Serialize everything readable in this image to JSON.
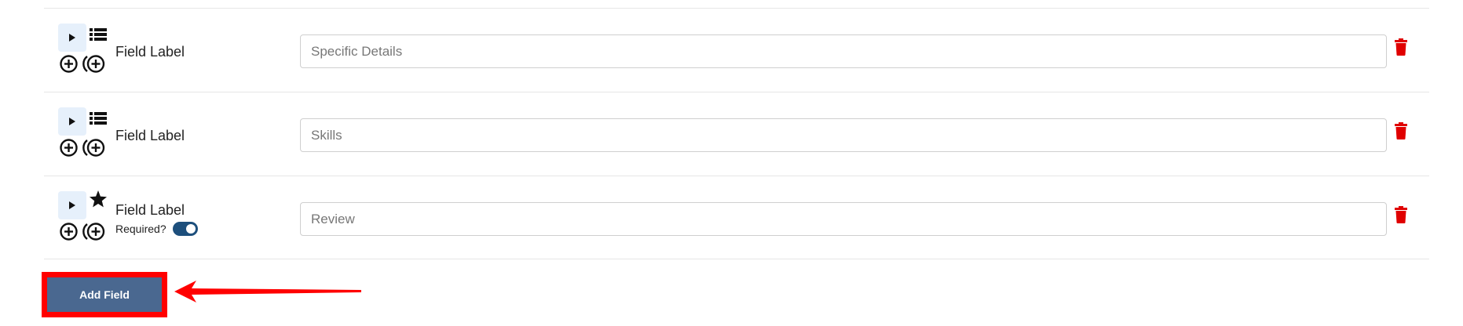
{
  "rows": [
    {
      "type_icon": "list-icon",
      "label": "Field Label",
      "input_placeholder": "Specific Details"
    },
    {
      "type_icon": "list-icon",
      "label": "Field Label",
      "input_placeholder": "Skills"
    },
    {
      "type_icon": "star-icon",
      "label": "Field Label",
      "input_placeholder": "Review",
      "required_label": "Required?",
      "required_on": true
    }
  ],
  "add_field_label": "Add Field",
  "colors": {
    "delete": "#e00000",
    "toggle_on": "#1d4f7c",
    "button_bg": "#4a6890",
    "annotation": "#ff0000",
    "expand_bg": "#e6f0fb"
  },
  "annotations": {
    "highlight_target": "add-field-button",
    "arrow_points_to": "add-field-button"
  }
}
